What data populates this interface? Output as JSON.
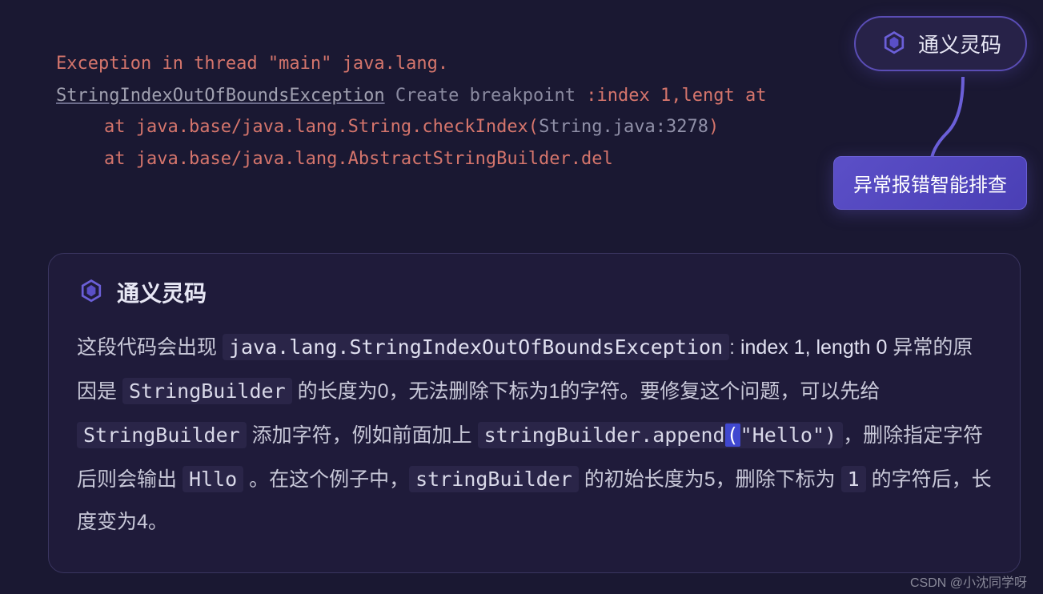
{
  "console": {
    "line1": "Exception in thread \"main\" java.lang.",
    "exception_name": "StringIndexOutOfBoundsException",
    "create_breakpoint": " Create breakpoint ",
    "line2_suffix": ":index 1,lengt at",
    "stack1_prefix": "at java.base/java.lang.String.checkIndex(",
    "stack1_location": "String.java:3278",
    "stack1_suffix": ")",
    "stack2_prefix": "at java.base/java.lang.AbstractStringBuilder.del"
  },
  "top_button": {
    "label": "通义灵码"
  },
  "helper_button": {
    "label": "异常报错智能排查"
  },
  "ai_panel": {
    "title": "通义灵码",
    "t1": "这段代码会出现 ",
    "c1": "java.lang.StringIndexOutOfBoundsException",
    "t1b": ":",
    "c2": "index 1, length 0",
    "t2": " 异常的原因是 ",
    "c3": "StringBuilder",
    "t3": " 的长度为0，无法删除下标为1的字符。要修复这个问题，可以先给 ",
    "c4": "StringBuilder",
    "t4": " 添加字符，例如前面加上 ",
    "c5a": "stringBuilder.append",
    "c5b": "(",
    "c5c": "\"Hello\")",
    "t5": "，删除指定字符后则会输出 ",
    "c6": "Hllo",
    "t6": " 。在这个例子中，",
    "c7": "stringBuilder",
    "t7": " 的初始长度为5，删除下标为 ",
    "c8": "1",
    "t8": " 的字符后，长度变为4。"
  },
  "watermark": "CSDN @小沈同学呀"
}
